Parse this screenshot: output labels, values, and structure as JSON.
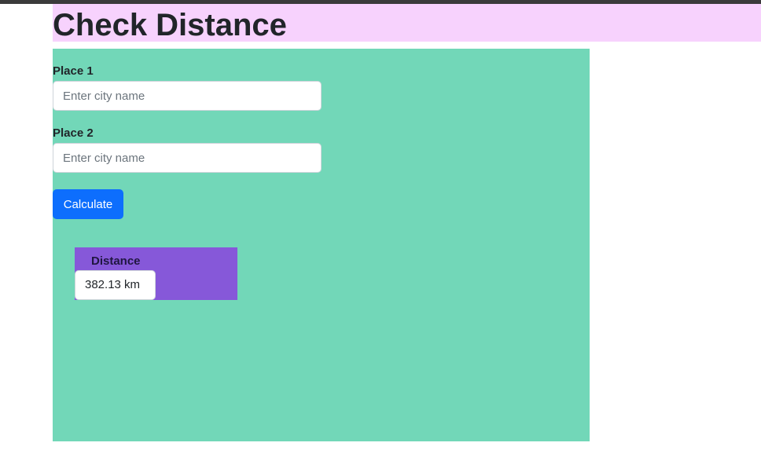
{
  "header": {
    "title": "Check Distance"
  },
  "form": {
    "place1_label": "Place 1",
    "place1_placeholder": "Enter city name",
    "place1_value": "",
    "place2_label": "Place 2",
    "place2_placeholder": "Enter city name",
    "place2_value": "",
    "calculate_label": "Calculate"
  },
  "result": {
    "label": "Distance",
    "value": "382.13 km"
  },
  "colors": {
    "header_bg": "#f7d2fd",
    "panel_bg": "#72d7b8",
    "result_bg": "#8658d9",
    "button_bg": "#0d6efd"
  }
}
